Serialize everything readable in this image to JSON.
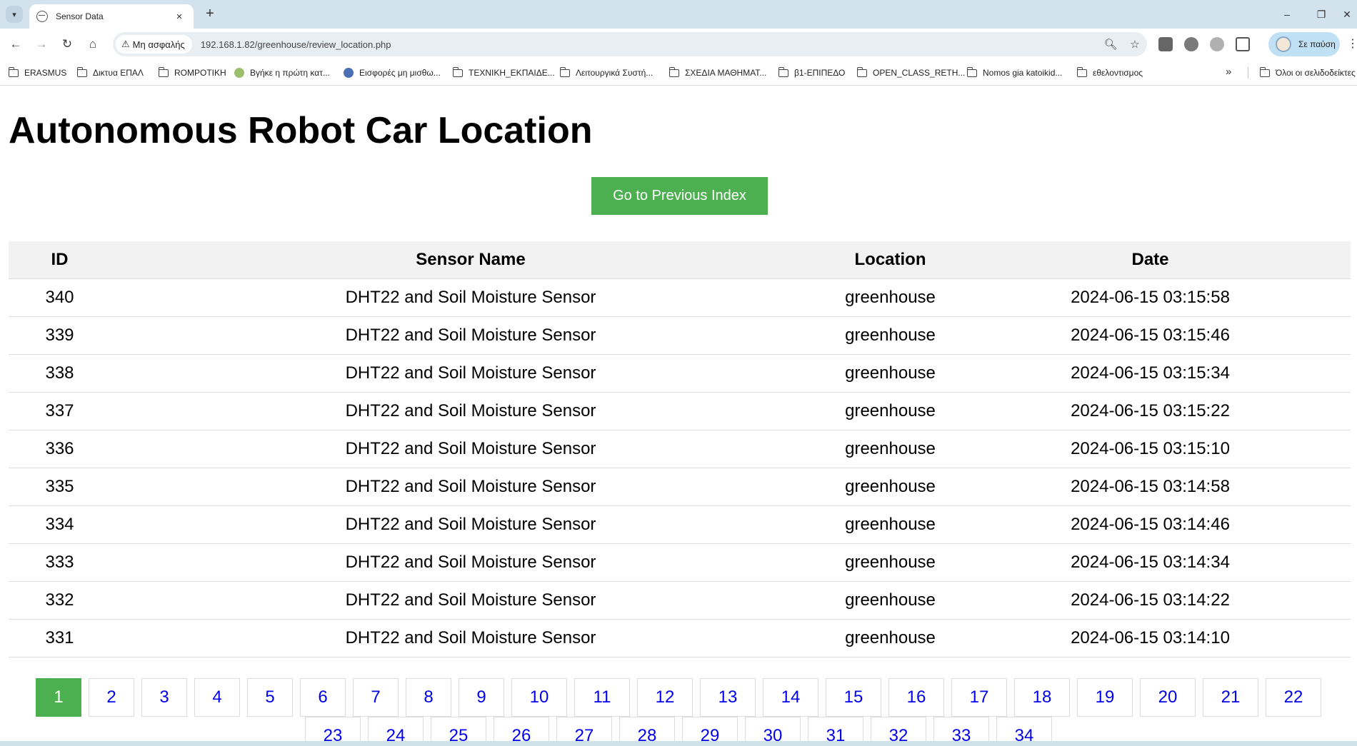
{
  "browser": {
    "tab_title": "Sensor Data",
    "tab_close_glyph": "×",
    "new_tab_glyph": "+",
    "security_label": "Μη ασφαλής",
    "url": "192.168.1.82/greenhouse/review_location.php",
    "profile_label": "Σε παύση",
    "window_controls": {
      "minimize": "–",
      "restore": "❐",
      "close": "✕"
    },
    "nav": {
      "back": "←",
      "forward": "→",
      "reload": "↻",
      "home": "⌂"
    },
    "icons": [
      "zoom-icon",
      "star-icon",
      "extension-icon",
      "puzzle-icon"
    ]
  },
  "bookmarks": {
    "items": [
      {
        "label": "ERASMUS",
        "icon": "folder-icon"
      },
      {
        "label": "Δικτυα ΕΠΑΛ",
        "icon": "folder-icon"
      },
      {
        "label": "ROMPOTIKH",
        "icon": "folder-icon"
      },
      {
        "label": "Βγήκε η πρώτη κατ...",
        "icon": "clover-icon"
      },
      {
        "label": "Εισφορές μη μισθω...",
        "icon": "plus-circle-icon"
      },
      {
        "label": "ΤΕΧΝΙΚΗ_ΕΚΠΑΙΔΕ...",
        "icon": "folder-icon"
      },
      {
        "label": "Λειτουργικά Συστή...",
        "icon": "folder-icon"
      },
      {
        "label": "ΣΧΕΔΙΑ ΜΑΘΗΜΑΤ...",
        "icon": "folder-icon"
      },
      {
        "label": "β1-ΕΠΙΠΕΔΟ",
        "icon": "folder-icon"
      },
      {
        "label": "OPEN_CLASS_RETH...",
        "icon": "folder-icon"
      },
      {
        "label": "Nomos gia katoikid...",
        "icon": "folder-icon"
      },
      {
        "label": "εθελοντισμος",
        "icon": "folder-icon"
      }
    ],
    "overflow": "»",
    "all_bookmarks": "Όλοι οι σελιδοδείκτες"
  },
  "page": {
    "title": "Autonomous Robot Car Location",
    "prev_button": "Go to Previous Index",
    "table": {
      "headers": [
        "ID",
        "Sensor Name",
        "Location",
        "Date"
      ],
      "rows": [
        [
          "340",
          "DHT22 and Soil Moisture Sensor",
          "greenhouse",
          "2024-06-15 03:15:58"
        ],
        [
          "339",
          "DHT22 and Soil Moisture Sensor",
          "greenhouse",
          "2024-06-15 03:15:46"
        ],
        [
          "338",
          "DHT22 and Soil Moisture Sensor",
          "greenhouse",
          "2024-06-15 03:15:34"
        ],
        [
          "337",
          "DHT22 and Soil Moisture Sensor",
          "greenhouse",
          "2024-06-15 03:15:22"
        ],
        [
          "336",
          "DHT22 and Soil Moisture Sensor",
          "greenhouse",
          "2024-06-15 03:15:10"
        ],
        [
          "335",
          "DHT22 and Soil Moisture Sensor",
          "greenhouse",
          "2024-06-15 03:14:58"
        ],
        [
          "334",
          "DHT22 and Soil Moisture Sensor",
          "greenhouse",
          "2024-06-15 03:14:46"
        ],
        [
          "333",
          "DHT22 and Soil Moisture Sensor",
          "greenhouse",
          "2024-06-15 03:14:34"
        ],
        [
          "332",
          "DHT22 and Soil Moisture Sensor",
          "greenhouse",
          "2024-06-15 03:14:22"
        ],
        [
          "331",
          "DHT22 and Soil Moisture Sensor",
          "greenhouse",
          "2024-06-15 03:14:10"
        ]
      ]
    },
    "pagination": {
      "current": "1",
      "pages": [
        "1",
        "2",
        "3",
        "4",
        "5",
        "6",
        "7",
        "8",
        "9",
        "10",
        "11",
        "12",
        "13",
        "14",
        "15",
        "16",
        "17",
        "18",
        "19",
        "20",
        "21",
        "22",
        "23",
        "24",
        "25",
        "26",
        "27",
        "28",
        "29",
        "30",
        "31",
        "32",
        "33",
        "34"
      ]
    }
  },
  "colors": {
    "accent_green": "#4caf50",
    "link_blue": "#0000ee",
    "header_bg": "#f2f2f2",
    "tabstrip_bg": "#d3e3ee"
  }
}
